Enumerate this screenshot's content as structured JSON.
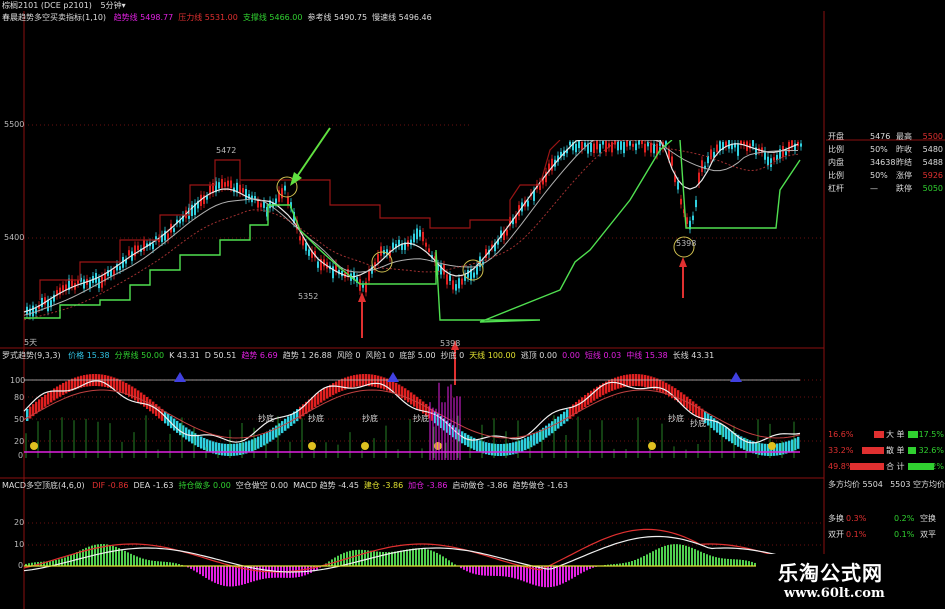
{
  "topbar": {
    "title": "棕榈2101 (DCE p2101)",
    "period": "5分钟",
    "arrow": "▾"
  },
  "main_panel": {
    "indicator_name": "春晨趋势多空买卖指标(1,10)",
    "labels": [
      {
        "text": "趋势线 5498.77",
        "color": "#e020e0"
      },
      {
        "text": "压力线 5531.00",
        "color": "#e03030"
      },
      {
        "text": "支撑线 5466.00",
        "color": "#30d030"
      },
      {
        "text": "参考线 5490.75",
        "color": "#dddddd"
      },
      {
        "text": "慢速线 5496.46",
        "color": "#dddddd"
      }
    ],
    "y_ticks": [
      "5500",
      "5400"
    ],
    "annotations": [
      "5472",
      "5352",
      "5398",
      "5398"
    ],
    "section_label": "5天"
  },
  "kdj_panel": {
    "indicator_name": "罗式趋势(9,3,3)",
    "labels": [
      {
        "text": "价格 15.38",
        "color": "#30c0e0"
      },
      {
        "text": "分界线 50.00",
        "color": "#30d030"
      },
      {
        "text": "K 43.31",
        "color": "#dddddd"
      },
      {
        "text": "D 50.51",
        "color": "#dddddd"
      },
      {
        "text": "趋势 6.69",
        "color": "#e020e0"
      },
      {
        "text": "趋势 1 26.88",
        "color": "#dddddd"
      },
      {
        "text": "风险 0",
        "color": "#dddddd"
      },
      {
        "text": "风险1 0",
        "color": "#dddddd"
      },
      {
        "text": "底部 5.00",
        "color": "#dddddd"
      },
      {
        "text": "抄底 0",
        "color": "#dddddd"
      },
      {
        "text": "天线 100.00",
        "color": "#e0e030"
      },
      {
        "text": "逃顶 0.00",
        "color": "#dddddd"
      },
      {
        "text": "0.00",
        "color": "#e020e0"
      },
      {
        "text": "短线 0.03",
        "color": "#e020e0"
      },
      {
        "text": "中线 15.38",
        "color": "#e020e0"
      },
      {
        "text": "长线 43.31",
        "color": "#dddddd"
      }
    ],
    "y_ticks": [
      "100",
      "80",
      "50",
      "20",
      "0"
    ],
    "signal_labels": [
      "抄底",
      "抄底",
      "抄底",
      "抄底",
      "抄底",
      "抄底"
    ]
  },
  "macd_panel": {
    "indicator_name": "MACD多空顶底(4,6,0)",
    "labels": [
      {
        "text": "DIF -0.86",
        "color": "#e03030"
      },
      {
        "text": "DEA -1.63",
        "color": "#dddddd"
      },
      {
        "text": "持仓做多 0.00",
        "color": "#30d030"
      },
      {
        "text": "空仓做空 0.00",
        "color": "#dddddd"
      },
      {
        "text": "MACD 趋势 -4.45",
        "color": "#dddddd"
      },
      {
        "text": "建仓 -3.86",
        "color": "#e0e030"
      },
      {
        "text": "加仓 -3.86",
        "color": "#e020e0"
      },
      {
        "text": "启动做仓 -3.86",
        "color": "#dddddd"
      },
      {
        "text": "趋势做仓 -1.63",
        "color": "#dddddd"
      }
    ],
    "y_ticks": [
      "20",
      "10",
      "0"
    ]
  },
  "side_panel": {
    "rows": [
      {
        "a": "开盘",
        "b": "5476",
        "c": "最高",
        "d": "5500"
      },
      {
        "a": "比例",
        "b": "50%",
        "c": "昨收",
        "d": "5480"
      },
      {
        "a": "内盘",
        "b": "34638",
        "c": "昨结",
        "d": "5488"
      },
      {
        "a": "比例",
        "b": "50%",
        "c": "涨停",
        "d": "5926"
      },
      {
        "a": "杠杆",
        "b": "—",
        "c": "跌停",
        "d": "5050"
      }
    ],
    "stats": [
      {
        "l": "16.6%",
        "m": "大 单",
        "r": "17.5%"
      },
      {
        "l": "33.2%",
        "m": "散 单",
        "r": "32.6%"
      },
      {
        "l": "49.8%",
        "m": "合 计",
        "r": "50.2%"
      }
    ],
    "avg_row": {
      "left": "多方均价 5504",
      "right": "5503 空方均价"
    },
    "bottom_rows": [
      {
        "l": "多换",
        "v": "0.3%",
        "r": "0.2%",
        "rl": "空换"
      },
      {
        "l": "双开",
        "v": "0.1%",
        "r": "0.1%",
        "rl": "双平"
      }
    ]
  },
  "watermark": {
    "title": "乐淘公式网",
    "url": "www.60lt.com"
  },
  "colors": {
    "up": "#e02020",
    "down": "#30d0e0",
    "support": "#50e050",
    "pressure": "#b01010",
    "magenta": "#e020e0",
    "arrow_green": "#60e040",
    "arrow_red": "#e03030"
  }
}
